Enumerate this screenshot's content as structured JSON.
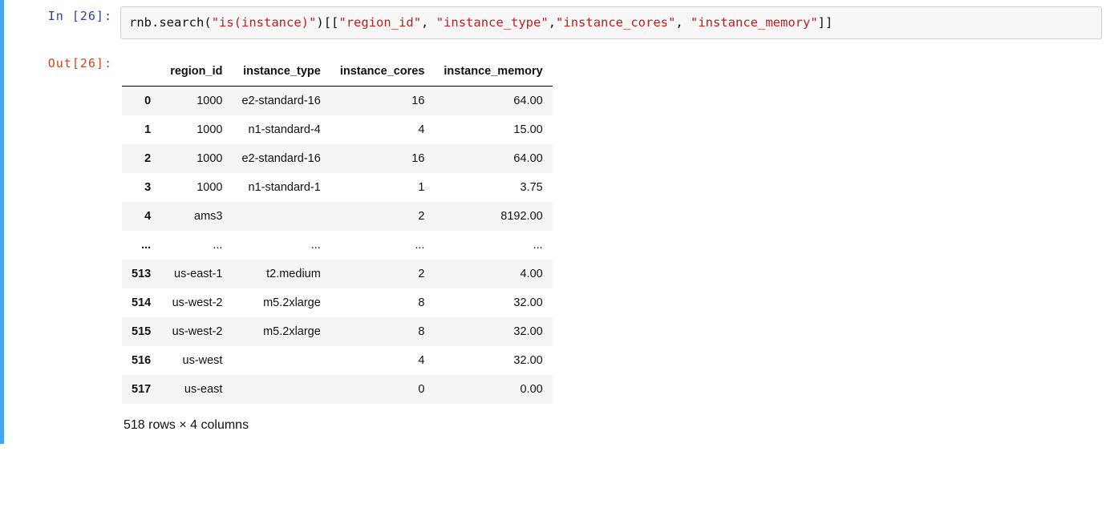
{
  "input": {
    "prompt": "In [26]:",
    "code": {
      "obj": "rnb",
      "dot": ".",
      "method": "search",
      "lp": "(",
      "arg": "\"is(instance)\"",
      "rp": ")",
      "lb1": "[",
      "lb2": "[",
      "c1": "\"region_id\"",
      "comma1": ", ",
      "c2": "\"instance_type\"",
      "comma2": ",",
      "c3": "\"instance_cores\"",
      "comma3": ", ",
      "c4": "\"instance_memory\"",
      "rb1": "]",
      "rb2": "]"
    }
  },
  "output": {
    "prompt": "Out[26]:",
    "columns": [
      "region_id",
      "instance_type",
      "instance_cores",
      "instance_memory"
    ],
    "rows": [
      {
        "idx": "0",
        "region_id": "1000",
        "instance_type": "e2-standard-16",
        "instance_cores": "16",
        "instance_memory": "64.00"
      },
      {
        "idx": "1",
        "region_id": "1000",
        "instance_type": "n1-standard-4",
        "instance_cores": "4",
        "instance_memory": "15.00"
      },
      {
        "idx": "2",
        "region_id": "1000",
        "instance_type": "e2-standard-16",
        "instance_cores": "16",
        "instance_memory": "64.00"
      },
      {
        "idx": "3",
        "region_id": "1000",
        "instance_type": "n1-standard-1",
        "instance_cores": "1",
        "instance_memory": "3.75"
      },
      {
        "idx": "4",
        "region_id": "ams3",
        "instance_type": "",
        "instance_cores": "2",
        "instance_memory": "8192.00"
      },
      {
        "idx": "...",
        "region_id": "...",
        "instance_type": "...",
        "instance_cores": "...",
        "instance_memory": "..."
      },
      {
        "idx": "513",
        "region_id": "us-east-1",
        "instance_type": "t2.medium",
        "instance_cores": "2",
        "instance_memory": "4.00"
      },
      {
        "idx": "514",
        "region_id": "us-west-2",
        "instance_type": "m5.2xlarge",
        "instance_cores": "8",
        "instance_memory": "32.00"
      },
      {
        "idx": "515",
        "region_id": "us-west-2",
        "instance_type": "m5.2xlarge",
        "instance_cores": "8",
        "instance_memory": "32.00"
      },
      {
        "idx": "516",
        "region_id": "us-west",
        "instance_type": "",
        "instance_cores": "4",
        "instance_memory": "32.00"
      },
      {
        "idx": "517",
        "region_id": "us-east",
        "instance_type": "",
        "instance_cores": "0",
        "instance_memory": "0.00"
      }
    ],
    "footer": "518 rows × 4 columns"
  }
}
